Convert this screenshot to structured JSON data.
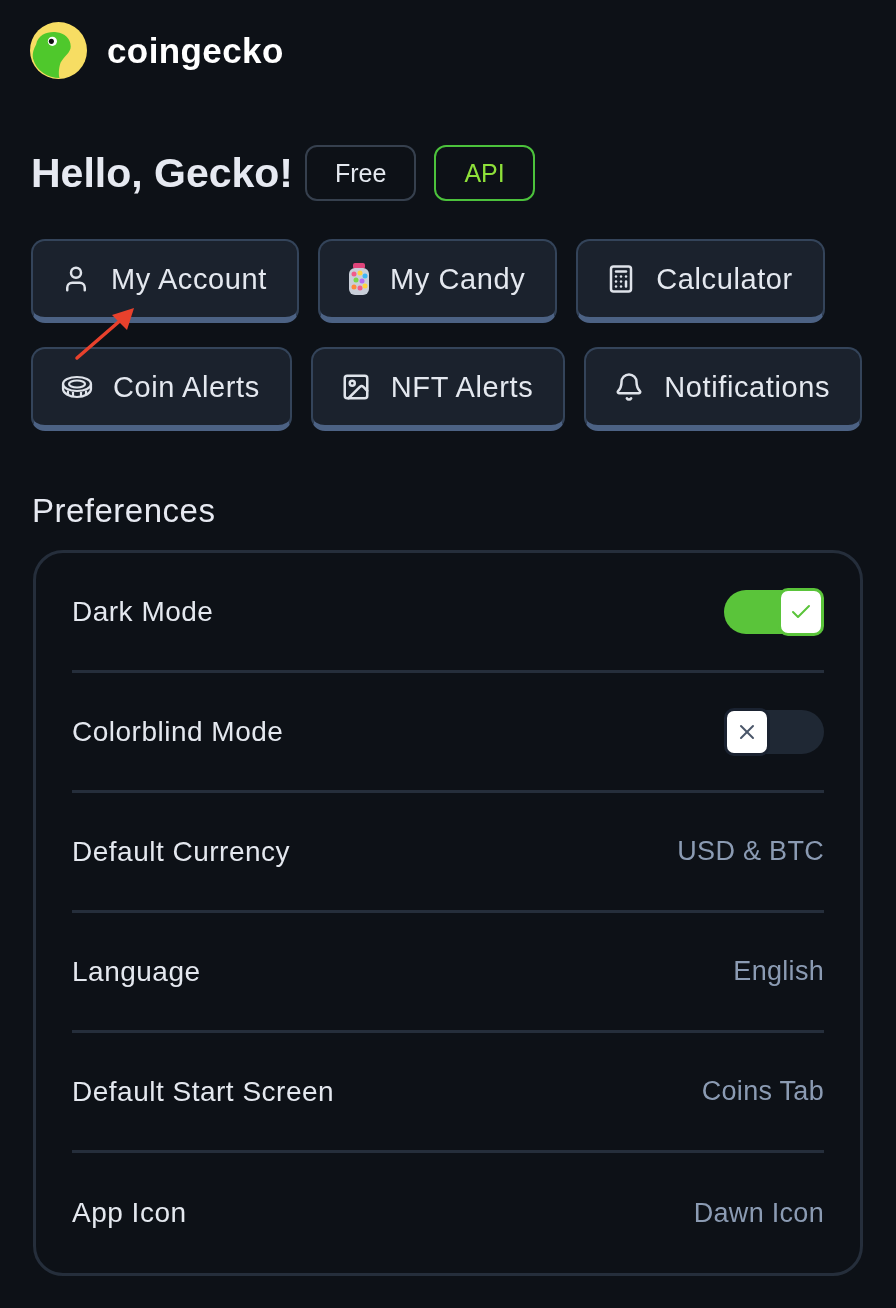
{
  "logo": {
    "wordmark": "coingecko"
  },
  "greeting": {
    "title": "Hello, Gecko!",
    "badges": [
      {
        "label": "Free",
        "kind": "plan"
      },
      {
        "label": "API",
        "kind": "api"
      }
    ]
  },
  "shortcuts": [
    {
      "label": "My Account",
      "kind": "account"
    },
    {
      "label": "My Candy",
      "kind": "candy"
    },
    {
      "label": "Calculator",
      "kind": "calculator"
    },
    {
      "label": "Coin Alerts",
      "kind": "coin"
    },
    {
      "label": "NFT Alerts",
      "kind": "nft"
    },
    {
      "label": "Notifications",
      "kind": "notification"
    }
  ],
  "preferences": {
    "title": "Preferences",
    "rows": [
      {
        "label": "Dark Mode",
        "kind": "toggle",
        "on": true
      },
      {
        "label": "Colorblind Mode",
        "kind": "toggle",
        "on": false
      },
      {
        "label": "Default Currency",
        "kind": "value",
        "value": "USD & BTC"
      },
      {
        "label": "Language",
        "kind": "value",
        "value": "English"
      },
      {
        "label": "Default Start Screen",
        "kind": "value",
        "value": "Coins Tab"
      },
      {
        "label": "App Icon",
        "kind": "value",
        "value": "Dawn Icon"
      }
    ]
  }
}
